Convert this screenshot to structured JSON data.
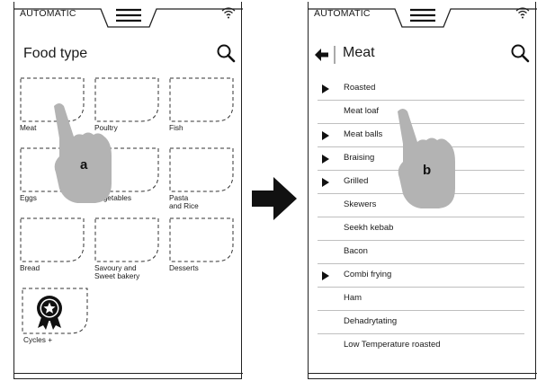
{
  "left_screen": {
    "status_label": "AUTOMATIC",
    "title": "Food type",
    "tiles": [
      {
        "label": "Meat"
      },
      {
        "label": "Poultry"
      },
      {
        "label": "Fish"
      },
      {
        "label": "Eggs"
      },
      {
        "label": "Vegetables"
      },
      {
        "label": "Pasta\nand Rice"
      },
      {
        "label": "Bread"
      },
      {
        "label": "Savoury and\nSweet bakery"
      },
      {
        "label": "Desserts"
      }
    ],
    "cycles_label": "Cycles +",
    "callout": "a"
  },
  "right_screen": {
    "status_label": "AUTOMATIC",
    "title": "Meat",
    "items": [
      {
        "label": "Roasted",
        "has_sub": true
      },
      {
        "label": "Meat loaf",
        "has_sub": false
      },
      {
        "label": "Meat balls",
        "has_sub": true
      },
      {
        "label": "Braising",
        "has_sub": true
      },
      {
        "label": "Grilled",
        "has_sub": true
      },
      {
        "label": "Skewers",
        "has_sub": false
      },
      {
        "label": "Seekh kebab",
        "has_sub": false
      },
      {
        "label": "Bacon",
        "has_sub": false
      },
      {
        "label": "Combi frying",
        "has_sub": true
      },
      {
        "label": "Ham",
        "has_sub": false
      },
      {
        "label": "Dehadrytating",
        "has_sub": false
      },
      {
        "label": "Low Temperature roasted",
        "has_sub": false
      }
    ],
    "callout": "b"
  },
  "icons": {
    "status": "wifi-icon",
    "menu": "menu-icon",
    "search": "search-icon",
    "back": "back-arrow-icon",
    "transition": "right-arrow-icon",
    "cycles": "award-star-icon",
    "submenu": "triangle-right-icon"
  }
}
